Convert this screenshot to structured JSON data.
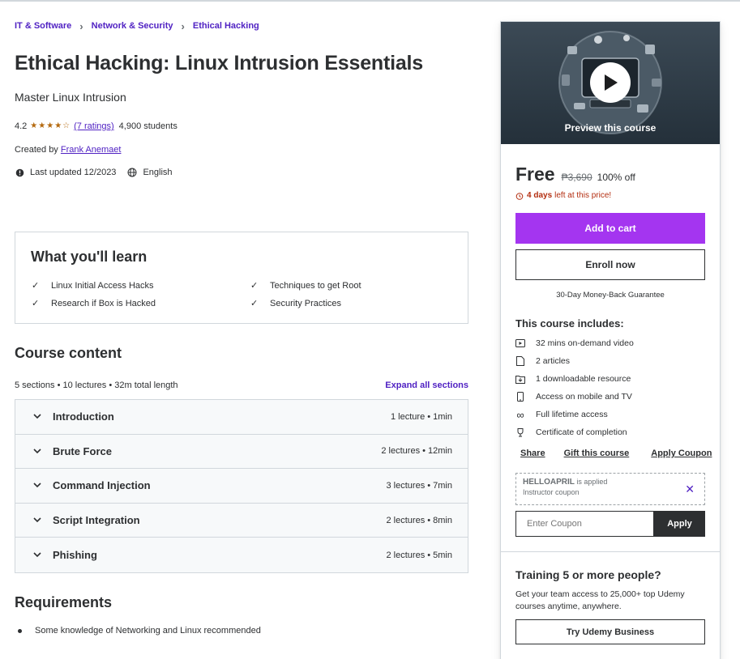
{
  "breadcrumb": [
    "IT & Software",
    "Network & Security",
    "Ethical Hacking"
  ],
  "course": {
    "title": "Ethical Hacking: Linux Intrusion Essentials",
    "subtitle": "Master Linux Intrusion",
    "rating": "4.2",
    "rating_stars": 4.2,
    "ratings_link": "(7 ratings)",
    "students": "4,900 students",
    "created_by_label": "Created by",
    "instructor": "Frank Anemaet",
    "last_updated": "Last updated 12/2023",
    "language": "English"
  },
  "learn": {
    "title": "What you'll learn",
    "items": [
      "Linux Initial Access Hacks",
      "Techniques to get Root",
      "Research if Box is Hacked",
      "Security Practices"
    ]
  },
  "content": {
    "title": "Course content",
    "meta": "5 sections • 10 lectures • 32m total length",
    "expand": "Expand all sections",
    "sections": [
      {
        "name": "Introduction",
        "info": "1 lecture • 1min"
      },
      {
        "name": "Brute Force",
        "info": "2 lectures • 12min"
      },
      {
        "name": "Command Injection",
        "info": "3 lectures • 7min"
      },
      {
        "name": "Script Integration",
        "info": "2 lectures • 8min"
      },
      {
        "name": "Phishing",
        "info": "2 lectures • 5min"
      }
    ]
  },
  "requirements": {
    "title": "Requirements",
    "items": [
      "Some knowledge of Networking and Linux recommended"
    ]
  },
  "sidebar": {
    "preview_label": "Preview this course",
    "price": "Free",
    "original_price": "₱3,690",
    "discount": "100% off",
    "deadline_bold": "4 days",
    "deadline_rest": "left at this price!",
    "add_to_cart": "Add to cart",
    "enroll": "Enroll now",
    "guarantee": "30-Day Money-Back Guarantee",
    "includes_title": "This course includes:",
    "includes": [
      {
        "icon": "video-icon",
        "text": "32 mins on-demand video"
      },
      {
        "icon": "article-icon",
        "text": "2 articles"
      },
      {
        "icon": "download-icon",
        "text": "1 downloadable resource"
      },
      {
        "icon": "mobile-icon",
        "text": "Access on mobile and TV"
      },
      {
        "icon": "infinity-icon",
        "text": "Full lifetime access"
      },
      {
        "icon": "trophy-icon",
        "text": "Certificate of completion"
      }
    ],
    "actions": [
      "Share",
      "Gift this course",
      "Apply Coupon"
    ],
    "coupon_code": "HELLOAPRIL",
    "coupon_applied": "is applied",
    "coupon_sub": "Instructor coupon",
    "coupon_placeholder": "Enter Coupon",
    "coupon_apply": "Apply",
    "biz_title": "Training 5 or more people?",
    "biz_desc": "Get your team access to 25,000+ top Udemy courses anytime, anywhere.",
    "biz_button": "Try Udemy Business"
  },
  "colors": {
    "accent": "#a435f0",
    "link": "#5022c3",
    "star": "#b4690e",
    "deadline": "#b32d0f",
    "text": "#2d2f31"
  }
}
